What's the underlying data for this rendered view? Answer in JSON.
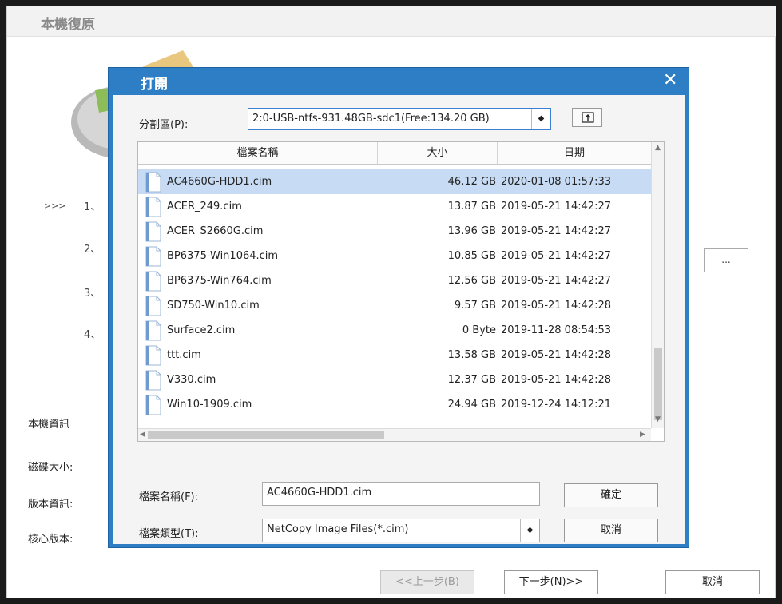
{
  "app": {
    "title": "本機復原",
    "steps_marker": ">>>",
    "steps": [
      "1、",
      "2、",
      "3、",
      "4、"
    ],
    "browse_label": "...",
    "info": {
      "section_label": "本機資訊",
      "disk_size_label": "磁碟大小:",
      "version_label": "版本資訊:",
      "kernel_label": "核心版本:"
    },
    "buttons": {
      "prev": "<<上一步(B)",
      "next": "下一步(N)>>",
      "cancel": "取消"
    }
  },
  "dialog": {
    "title": "打開",
    "close_glyph": "✕",
    "partition": {
      "label": "分割區(P):",
      "value": "2:0-USB-ntfs-931.48GB-sdc1(Free:134.20 GB)",
      "arrow": "◆"
    },
    "columns": {
      "name": "檔案名稱",
      "size": "大小",
      "date": "日期"
    },
    "files": [
      {
        "name": "AC4660G-HDD1.cim",
        "size": "46.12 GB",
        "date": "2020-01-08 01:57:33",
        "selected": true
      },
      {
        "name": "ACER_249.cim",
        "size": "13.87 GB",
        "date": "2019-05-21 14:42:27"
      },
      {
        "name": "ACER_S2660G.cim",
        "size": "13.96 GB",
        "date": "2019-05-21 14:42:27"
      },
      {
        "name": "BP6375-Win1064.cim",
        "size": "10.85 GB",
        "date": "2019-05-21 14:42:27"
      },
      {
        "name": "BP6375-Win764.cim",
        "size": "12.56 GB",
        "date": "2019-05-21 14:42:27"
      },
      {
        "name": "SD750-Win10.cim",
        "size": "9.57 GB",
        "date": "2019-05-21 14:42:28"
      },
      {
        "name": "Surface2.cim",
        "size": "0 Byte",
        "date": "2019-11-28 08:54:53"
      },
      {
        "name": "ttt.cim",
        "size": "13.58 GB",
        "date": "2019-05-21 14:42:28"
      },
      {
        "name": "V330.cim",
        "size": "12.37 GB",
        "date": "2019-05-21 14:42:28"
      },
      {
        "name": "Win10-1909.cim",
        "size": "24.94 GB",
        "date": "2019-12-24 14:12:21"
      }
    ],
    "filename": {
      "label": "檔案名稱(F):",
      "value": "AC4660G-HDD1.cim"
    },
    "filetype": {
      "label": "檔案類型(T):",
      "value": "NetCopy Image Files(*.cim)",
      "arrow": "◆"
    },
    "ok_label": "確定",
    "cancel_label": "取消"
  }
}
